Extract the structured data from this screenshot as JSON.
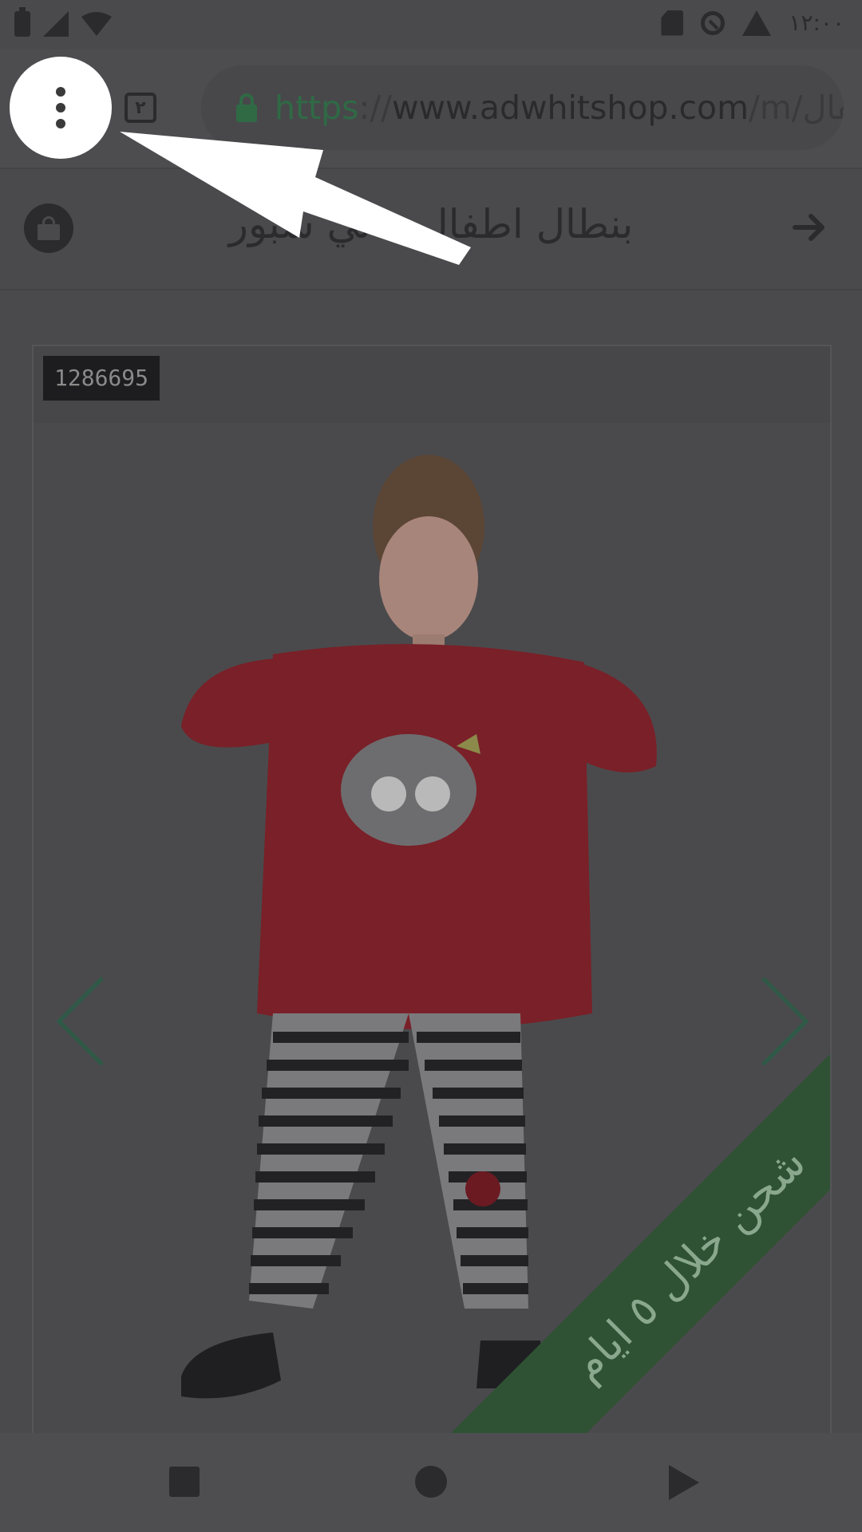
{
  "status_bar": {
    "time": "١٢:٠٠",
    "icons": [
      "battery-icon",
      "signal-icon",
      "wifi-icon",
      "sd-card-icon",
      "data-saver-icon",
      "warning-icon"
    ]
  },
  "browser": {
    "tab_count": "٢",
    "url": {
      "scheme": "https",
      "separator": "://",
      "domain": "www.adwhitshop.com",
      "path": "/m/طفال"
    },
    "menu_icon": "more-vert-icon"
  },
  "page": {
    "title": "بنطال اطفال بناتي سبور",
    "cart_icon": "shopping-bag-icon",
    "back_icon": "arrow-forward-icon"
  },
  "product": {
    "sku": "1286695",
    "ribbon_text": "شحن خلال ٥ ايام",
    "image_description": "product-photo",
    "colors": {
      "ribbon": "#2f5234",
      "shirt": "#7a2028",
      "accent": "#2f6a45"
    }
  },
  "navigation": {
    "icons": [
      "back-square-icon",
      "home-circle-icon",
      "recent-triangle-icon"
    ]
  }
}
